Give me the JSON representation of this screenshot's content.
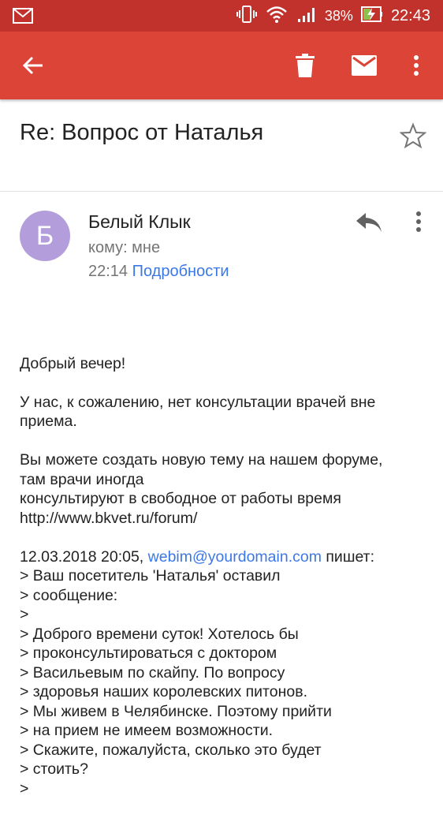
{
  "status_bar": {
    "battery_percent": "38%",
    "time": "22:43",
    "colors": {
      "background": "#c1322d"
    }
  },
  "app_bar": {
    "color": "#db4437",
    "icons": [
      "back-arrow-icon",
      "trash-icon",
      "mail-icon",
      "more-vert-icon"
    ]
  },
  "email": {
    "subject": "Re: Вопрос от Наталья",
    "sender": {
      "avatar_letter": "Б",
      "name": "Белый Клык",
      "to": "кому: мне",
      "time": "22:14",
      "details_label": "Подробности"
    },
    "body": {
      "greeting": "Добрый вечер!",
      "p1_l1": "У нас, к сожалению, нет консультации врачей вне",
      "p1_l2": "приема.",
      "p2_l1": "Вы можете создать новую тему на нашем форуме,",
      "p2_l2": "там врачи иногда",
      "p2_l3": "консультируют в свободное от работы время",
      "p2_l4": "http://www.bkvet.ru/forum/",
      "quote_header_prefix": "12.03.2018 20:05, ",
      "quote_header_email": "webim@yourdomain.com",
      "quote_header_suffix": " пишет:",
      "quote_lines": [
        "> Ваш посетитель 'Наталья' оставил",
        "> сообщение:",
        ">",
        "> Доброго времени суток! Хотелось бы",
        "> проконсультироваться с доктором",
        "> Васильевым по скайпу. По вопросу",
        "> здоровья наших королевских питонов.",
        "> Мы живем в Челябинске. Поэтому прийти",
        "> на прием не имеем возможности.",
        "> Скажите, пожалуйста, сколько это будет",
        "> стоить?",
        ">"
      ]
    }
  }
}
